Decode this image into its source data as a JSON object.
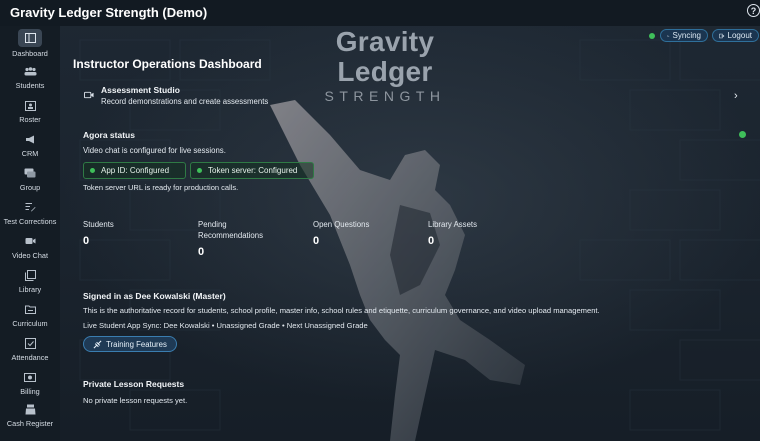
{
  "app": {
    "title": "Gravity Ledger Strength (Demo)",
    "help_label": "?"
  },
  "brand": {
    "name": "Gravity Ledger",
    "tagline": "STRENGTH"
  },
  "header": {
    "sync_label": "Syncing",
    "logout_label": "Logout"
  },
  "sidebar": {
    "items": [
      {
        "label": "Dashboard",
        "icon": "dashboard-icon",
        "active": true
      },
      {
        "label": "Students",
        "icon": "students-icon"
      },
      {
        "label": "Roster",
        "icon": "roster-icon"
      },
      {
        "label": "CRM",
        "icon": "megaphone-icon"
      },
      {
        "label": "Group",
        "icon": "chat-icon"
      },
      {
        "label": "Test Corrections",
        "icon": "edit-list-icon"
      },
      {
        "label": "Video Chat",
        "icon": "video-icon"
      },
      {
        "label": "Library",
        "icon": "library-icon"
      },
      {
        "label": "Curriculum",
        "icon": "folder-icon"
      },
      {
        "label": "Attendance",
        "icon": "attendance-icon"
      },
      {
        "label": "Billing",
        "icon": "billing-icon"
      },
      {
        "label": "Cash Register",
        "icon": "register-icon"
      }
    ]
  },
  "main": {
    "title": "Instructor Operations Dashboard",
    "studio": {
      "title": "Assessment Studio",
      "subtitle": "Record demonstrations and create assessments"
    },
    "agora": {
      "title": "Agora status",
      "subtitle": "Video chat is configured for live sessions.",
      "badges": [
        "App ID: Configured",
        "Token server: Configured"
      ],
      "note": "Token server URL is ready for production calls."
    },
    "stats": [
      {
        "label": "Students",
        "value": "0"
      },
      {
        "label": "Pending Recommendations",
        "value": "0"
      },
      {
        "label": "Open Questions",
        "value": "0"
      },
      {
        "label": "Library Assets",
        "value": "0"
      }
    ],
    "signed_in": {
      "title": "Signed in as Dee Kowalski (Master)",
      "description": "This is the authoritative record for students, school profile, master info, school rules and etiquette, curriculum governance, and video upload management.",
      "sync_line": "Live Student App Sync: Dee Kowalski • Unassigned Grade • Next Unassigned Grade",
      "button_label": "Training Features"
    },
    "private_lessons": {
      "title": "Private Lesson Requests",
      "empty_text": "No private lesson requests yet."
    }
  },
  "colors": {
    "accent_blue": "#3a7db0",
    "status_green": "#3fbf5a",
    "background": "#1b2430"
  }
}
